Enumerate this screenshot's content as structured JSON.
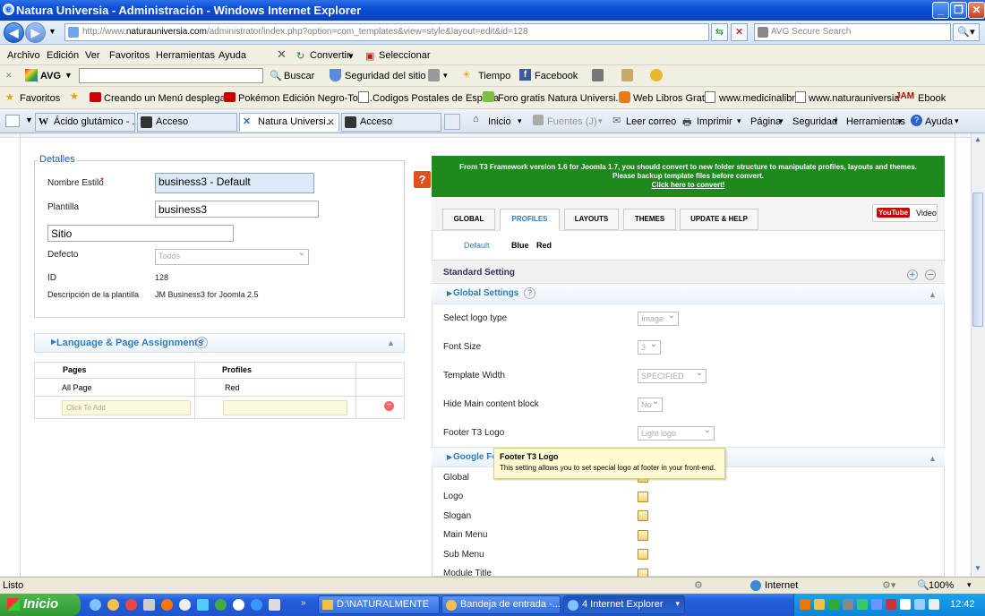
{
  "window": {
    "title": "Natura Universia - Administración - Windows Internet Explorer",
    "min": "_",
    "max": "❐",
    "close": "✕"
  },
  "address": {
    "prefix": "http://www.",
    "domain": "naturauniversia.com",
    "path": "/administrator/index.php?option=com_templates&view=style&layout=edit&id=128",
    "search_placeholder": "AVG Secure Search"
  },
  "menu": {
    "items": [
      "Archivo",
      "Edición",
      "Ver",
      "Favoritos",
      "Herramientas",
      "Ayuda"
    ],
    "convert": "Convertir",
    "select": "Seleccionar"
  },
  "avgbar": {
    "logo": "AVG",
    "search": "Buscar",
    "safety": "Seguridad del sitio",
    "weather": "Tiempo",
    "facebook": "Facebook"
  },
  "favorites": {
    "label": "Favoritos",
    "items": [
      "Creando un Menú desplega...",
      "Pokémon Edición Negro-Torr...",
      "Codigos Postales de España",
      "Foro gratis  Natura Universi...",
      "Web Libros Gratis",
      "www.medicinalibre",
      "www.naturauniversia",
      "Ebook"
    ]
  },
  "tabs": [
    {
      "label": "Ácido glutámico - ..."
    },
    {
      "label": "Acceso"
    },
    {
      "label": "Natura Universi..."
    },
    {
      "label": "Acceso"
    }
  ],
  "cmdbar": {
    "home": "Inicio",
    "feeds": "Fuentes (J)",
    "mail": "Leer correo",
    "print": "Imprimir",
    "page": "Página",
    "security": "Seguridad",
    "tools": "Herramientas",
    "help": "Ayuda"
  },
  "details": {
    "legend": "Detalles",
    "style_name_label": "Nombre Estilo",
    "required": "*",
    "style_name": "business3 - Default",
    "template_label": "Plantilla",
    "template": "business3",
    "site": "Sitio",
    "default_label": "Defecto",
    "default_value": "Todos",
    "id_label": "ID",
    "id": "128",
    "desc_label": "Descripción de la plantilla",
    "desc": "JM Business3 for Joomla 2.5"
  },
  "assign": {
    "title": "Language & Page Assignments",
    "help": "?",
    "col_pages": "Pages",
    "col_profiles": "Profiles",
    "page": "All Page",
    "profile": "Red",
    "add_placeholder": "Click To Add"
  },
  "notice": {
    "line1": "From T3 Framework version 1.6 for Joomla 1.7, you should convert to new folder structure to manipulate profiles, layouts and themes.",
    "line2": "Please backup template files before convert.",
    "link": "Click here to convert!"
  },
  "t3tabs": [
    "GLOBAL",
    "PROFILES",
    "LAYOUTS",
    "THEMES",
    "UPDATE & HELP"
  ],
  "video": {
    "yt": "YouTube",
    "label": "Video"
  },
  "profiles": [
    "Default",
    "Blue",
    "Red"
  ],
  "standard": "Standard Setting",
  "global_settings": "Global Settings",
  "settings": [
    {
      "label": "Select logo type",
      "value": "Image"
    },
    {
      "label": "Font Size",
      "value": "3"
    },
    {
      "label": "Template Width",
      "value": "SPECIFIED"
    },
    {
      "label": "Hide Main content block",
      "value": "No"
    },
    {
      "label": "Footer T3 Logo",
      "value": "Light logo"
    }
  ],
  "google_fonts": "Google Fo",
  "tooltip": {
    "title": "Footer T3 Logo",
    "text": "This setting allows you to set special logo at footer in your front-end."
  },
  "font_rows": [
    "Global",
    "Logo",
    "Slogan",
    "Main Menu",
    "Sub Menu",
    "Module Title"
  ],
  "status": {
    "text": "Listo",
    "zone": "Internet",
    "zoom": "100%"
  },
  "taskbar": {
    "start": "Inicio",
    "items": [
      "D:\\NATURALMENTE",
      "Bandeja de entrada -...",
      "4 Internet Explorer"
    ],
    "clock": "12:42"
  }
}
